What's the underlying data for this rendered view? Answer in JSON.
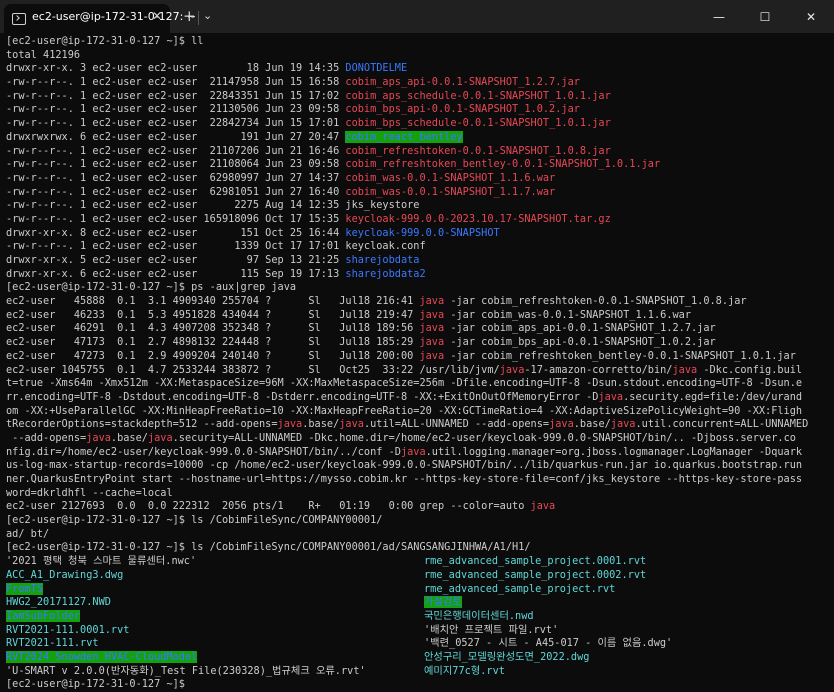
{
  "window": {
    "tab_title": "ec2-user@ip-172-31-0-127: ~",
    "tab_close": "✕",
    "new_tab": "+",
    "tab_menu": "⌄",
    "minimize": "—",
    "maximize": "☐",
    "close": "✕"
  },
  "colors": {
    "background": "#0c0c0c",
    "text": "#cccccc",
    "directory": "#3b78ff",
    "archive": "#e74856",
    "highlight_bg": "#13a10e",
    "match": "#e74856"
  },
  "terminal": [
    [
      {
        "t": "[ec2-user@ip-172-31-0-127 ~]$ ll"
      }
    ],
    [
      {
        "t": "total 412196"
      }
    ],
    [
      {
        "t": "drwxr-xr-x. 3 ec2-user ec2-user        18 Jun 19 14:35 "
      },
      {
        "t": "DONOTDELME",
        "c": "blue"
      }
    ],
    [
      {
        "t": "-rw-r--r--. 1 ec2-user ec2-user  21147958 Jun 15 16:58 "
      },
      {
        "t": "cobim_aps_api-0.0.1-SNAPSHOT_1.2.7.jar",
        "c": "red"
      }
    ],
    [
      {
        "t": "-rw-r--r--. 1 ec2-user ec2-user  22843351 Jun 15 17:02 "
      },
      {
        "t": "cobim_aps_schedule-0.0.1-SNAPSHOT_1.0.1.jar",
        "c": "red"
      }
    ],
    [
      {
        "t": "-rw-r--r--. 1 ec2-user ec2-user  21130506 Jun 23 09:58 "
      },
      {
        "t": "cobim_bps_api-0.0.1-SNAPSHOT_1.0.2.jar",
        "c": "red"
      }
    ],
    [
      {
        "t": "-rw-r--r--. 1 ec2-user ec2-user  22842734 Jun 15 17:01 "
      },
      {
        "t": "cobim_bps_schedule-0.0.1-SNAPSHOT_1.0.1.jar",
        "c": "red"
      }
    ],
    [
      {
        "t": "drwxrwxrwx. 6 ec2-user ec2-user       191 Jun 27 20:47 "
      },
      {
        "t": "cobim_react_bentley",
        "c": "hl"
      }
    ],
    [
      {
        "t": "-rw-r--r--. 1 ec2-user ec2-user  21107206 Jun 21 16:46 "
      },
      {
        "t": "cobim_refreshtoken-0.0.1-SNAPSHOT_1.0.8.jar",
        "c": "red"
      }
    ],
    [
      {
        "t": "-rw-r--r--. 1 ec2-user ec2-user  21108064 Jun 23 09:58 "
      },
      {
        "t": "cobim_refreshtoken_bentley-0.0.1-SNAPSHOT_1.0.1.jar",
        "c": "red"
      }
    ],
    [
      {
        "t": "-rw-r--r--. 1 ec2-user ec2-user  62980997 Jun 27 14:37 "
      },
      {
        "t": "cobim_was-0.0.1-SNAPSHOT_1.1.6.war",
        "c": "red"
      }
    ],
    [
      {
        "t": "-rw-r--r--. 1 ec2-user ec2-user  62981051 Jun 27 16:40 "
      },
      {
        "t": "cobim_was-0.0.1-SNAPSHOT_1.1.7.war",
        "c": "red"
      }
    ],
    [
      {
        "t": "-rw-r--r--. 1 ec2-user ec2-user      2275 Aug 14 12:35 jks_keystore"
      }
    ],
    [
      {
        "t": "-rw-r--r--. 1 ec2-user ec2-user 165918096 Oct 17 15:35 "
      },
      {
        "t": "keycloak-999.0.0-2023.10.17-SNAPSHOT.tar.gz",
        "c": "red"
      }
    ],
    [
      {
        "t": "drwxr-xr-x. 8 ec2-user ec2-user       151 Oct 25 16:44 "
      },
      {
        "t": "keycloak-999.0.0-SNAPSHOT",
        "c": "blue"
      }
    ],
    [
      {
        "t": "-rw-r--r--. 1 ec2-user ec2-user      1339 Oct 17 17:01 keycloak.conf"
      }
    ],
    [
      {
        "t": "drwxr-xr-x. 5 ec2-user ec2-user        97 Sep 13 21:25 "
      },
      {
        "t": "sharejobdata",
        "c": "blue"
      }
    ],
    [
      {
        "t": "drwxr-xr-x. 6 ec2-user ec2-user       115 Sep 19 17:13 "
      },
      {
        "t": "sharejobdata2",
        "c": "blue"
      }
    ],
    [
      {
        "t": "[ec2-user@ip-172-31-0-127 ~]$ ps -aux|grep java"
      }
    ],
    [
      {
        "t": "ec2-user   45888  0.1  3.1 4909340 255704 ?      Sl   Jul18 216:41 "
      },
      {
        "t": "java",
        "c": "red"
      },
      {
        "t": " -jar cobim_refreshtoken-0.0.1-SNAPSHOT_1.0.8.jar"
      }
    ],
    [
      {
        "t": "ec2-user   46233  0.1  5.3 4951828 434044 ?      Sl   Jul18 219:47 "
      },
      {
        "t": "java",
        "c": "red"
      },
      {
        "t": " -jar cobim_was-0.0.1-SNAPSHOT_1.1.6.war"
      }
    ],
    [
      {
        "t": "ec2-user   46291  0.1  4.3 4907208 352348 ?      Sl   Jul18 189:56 "
      },
      {
        "t": "java",
        "c": "red"
      },
      {
        "t": " -jar cobim_aps_api-0.0.1-SNAPSHOT_1.2.7.jar"
      }
    ],
    [
      {
        "t": "ec2-user   47173  0.1  2.7 4898132 224448 ?      Sl   Jul18 185:29 "
      },
      {
        "t": "java",
        "c": "red"
      },
      {
        "t": " -jar cobim_bps_api-0.0.1-SNAPSHOT_1.0.2.jar"
      }
    ],
    [
      {
        "t": "ec2-user   47273  0.1  2.9 4909204 240140 ?      Sl   Jul18 200:00 "
      },
      {
        "t": "java",
        "c": "red"
      },
      {
        "t": " -jar cobim_refreshtoken_bentley-0.0.1-SNAPSHOT_1.0.1.jar"
      }
    ],
    [
      {
        "t": "ec2-user 1045755  0.1  4.7 2533244 383872 ?      Sl   Oct25  33:22 /usr/lib/jvm/"
      },
      {
        "t": "java",
        "c": "red"
      },
      {
        "t": "-17-amazon-corretto/bin/"
      },
      {
        "t": "java",
        "c": "red"
      },
      {
        "t": " -Dkc.config.buil"
      }
    ],
    [
      {
        "t": "t=true -Xms64m -Xmx512m -XX:MetaspaceSize=96M -XX:MaxMetaspaceSize=256m -Dfile.encoding=UTF-8 -Dsun.stdout.encoding=UTF-8 -Dsun.e"
      }
    ],
    [
      {
        "t": "rr.encoding=UTF-8 -Dstdout.encoding=UTF-8 -Dstderr.encoding=UTF-8 -XX:+ExitOnOutOfMemoryError -D"
      },
      {
        "t": "java",
        "c": "red"
      },
      {
        "t": ".security.egd=file:/dev/urand"
      }
    ],
    [
      {
        "t": "om -XX:+UseParallelGC -XX:MinHeapFreeRatio=10 -XX:MaxHeapFreeRatio=20 -XX:GCTimeRatio=4 -XX:AdaptiveSizePolicyWeight=90 -XX:Fligh"
      }
    ],
    [
      {
        "t": "tRecorderOptions=stackdepth=512 --add-opens="
      },
      {
        "t": "java",
        "c": "red"
      },
      {
        "t": ".base/"
      },
      {
        "t": "java",
        "c": "red"
      },
      {
        "t": ".util=ALL-UNNAMED --add-opens="
      },
      {
        "t": "java",
        "c": "red"
      },
      {
        "t": ".base/"
      },
      {
        "t": "java",
        "c": "red"
      },
      {
        "t": ".util.concurrent=ALL-UNNAMED"
      }
    ],
    [
      {
        "t": " --add-opens="
      },
      {
        "t": "java",
        "c": "red"
      },
      {
        "t": ".base/"
      },
      {
        "t": "java",
        "c": "red"
      },
      {
        "t": ".security=ALL-UNNAMED -Dkc.home.dir=/home/ec2-user/keycloak-999.0.0-SNAPSHOT/bin/.. -Djboss.server.co"
      }
    ],
    [
      {
        "t": "nfig.dir=/home/ec2-user/keycloak-999.0.0-SNAPSHOT/bin/../conf -D"
      },
      {
        "t": "java",
        "c": "red"
      },
      {
        "t": ".util.logging.manager=org.jboss.logmanager.LogManager -Dquark"
      }
    ],
    [
      {
        "t": "us-log-max-startup-records=10000 -cp /home/ec2-user/keycloak-999.0.0-SNAPSHOT/bin/../lib/quarkus-run.jar io.quarkus.bootstrap.run"
      }
    ],
    [
      {
        "t": "ner.QuarkusEntryPoint start --hostname-url=https://mysso.cobim.kr --https-key-store-file=conf/jks_keystore --https-key-store-pass"
      }
    ],
    [
      {
        "t": "word=dkrldhfl --cache=local"
      }
    ],
    [
      {
        "t": "ec2-user 2127693  0.0  0.0 222312  2056 pts/1    R+   01:19   0:00 grep --color=auto "
      },
      {
        "t": "java",
        "c": "red"
      }
    ],
    [
      {
        "t": "[ec2-user@ip-172-31-0-127 ~]$ ls /CobimFileSync/COMPANY00001/"
      }
    ],
    [
      {
        "t": "ad/ bt/"
      }
    ],
    [
      {
        "t": "[ec2-user@ip-172-31-0-127 ~]$ ls /CobimFileSync/COMPANY00001/ad/SANGSANGJINHWA/A1/H1/"
      }
    ]
  ],
  "listing_left": [
    [
      {
        "t": "'2021 평택 청북 스마트 물류센터.nwc'"
      }
    ],
    [
      {
        "t": "ACC_A1_Drawing3.dwg",
        "c": "cyan"
      }
    ],
    [
      {
        "t": "FromTS",
        "c": "hl"
      }
    ],
    [
      {
        "t": "HWG2_20171127.NWD",
        "c": "cyan"
      }
    ],
    [
      {
        "t": "IamSubFolder",
        "c": "hl"
      }
    ],
    [
      {
        "t": "RVT2021-111.0001.rvt",
        "c": "cyan"
      }
    ],
    [
      {
        "t": "RVT2021-111.rvt",
        "c": "cyan"
      }
    ],
    [
      {
        "t": "RVT2024_Snowden_HVAC-CloudModel",
        "c": "hl"
      }
    ],
    [
      {
        "t": "'U-SMART v 2.0.0(반자동화)_Test File(230328)_법규체크 오류.rvt'"
      }
    ]
  ],
  "listing_right": [
    [
      {
        "t": "rme_advanced_sample_project.0001.rvt",
        "c": "cyan"
      }
    ],
    [
      {
        "t": "rme_advanced_sample_project.0002.rvt",
        "c": "cyan"
      }
    ],
    [
      {
        "t": "rme_advanced_sample_project.rvt",
        "c": "cyan"
      }
    ],
    [
      {
        "t": "가설검토",
        "c": "hl"
      }
    ],
    [
      {
        "t": "국민은행데이터센터.nwd",
        "c": "cyan"
      }
    ],
    [
      {
        "t": "'배치안 프로젝트 파일.rvt'"
      }
    ],
    [
      {
        "t": "'백련_0527 - 시트 - A45-017 - 이름 없음.dwg'"
      }
    ],
    [
      {
        "t": "안성구리_모델링완성도면_2022.dwg",
        "c": "cyan"
      }
    ],
    [
      {
        "t": "예미지77c형.rvt",
        "c": "cyan"
      }
    ]
  ],
  "final_prompt": "[ec2-user@ip-172-31-0-127 ~]$ "
}
